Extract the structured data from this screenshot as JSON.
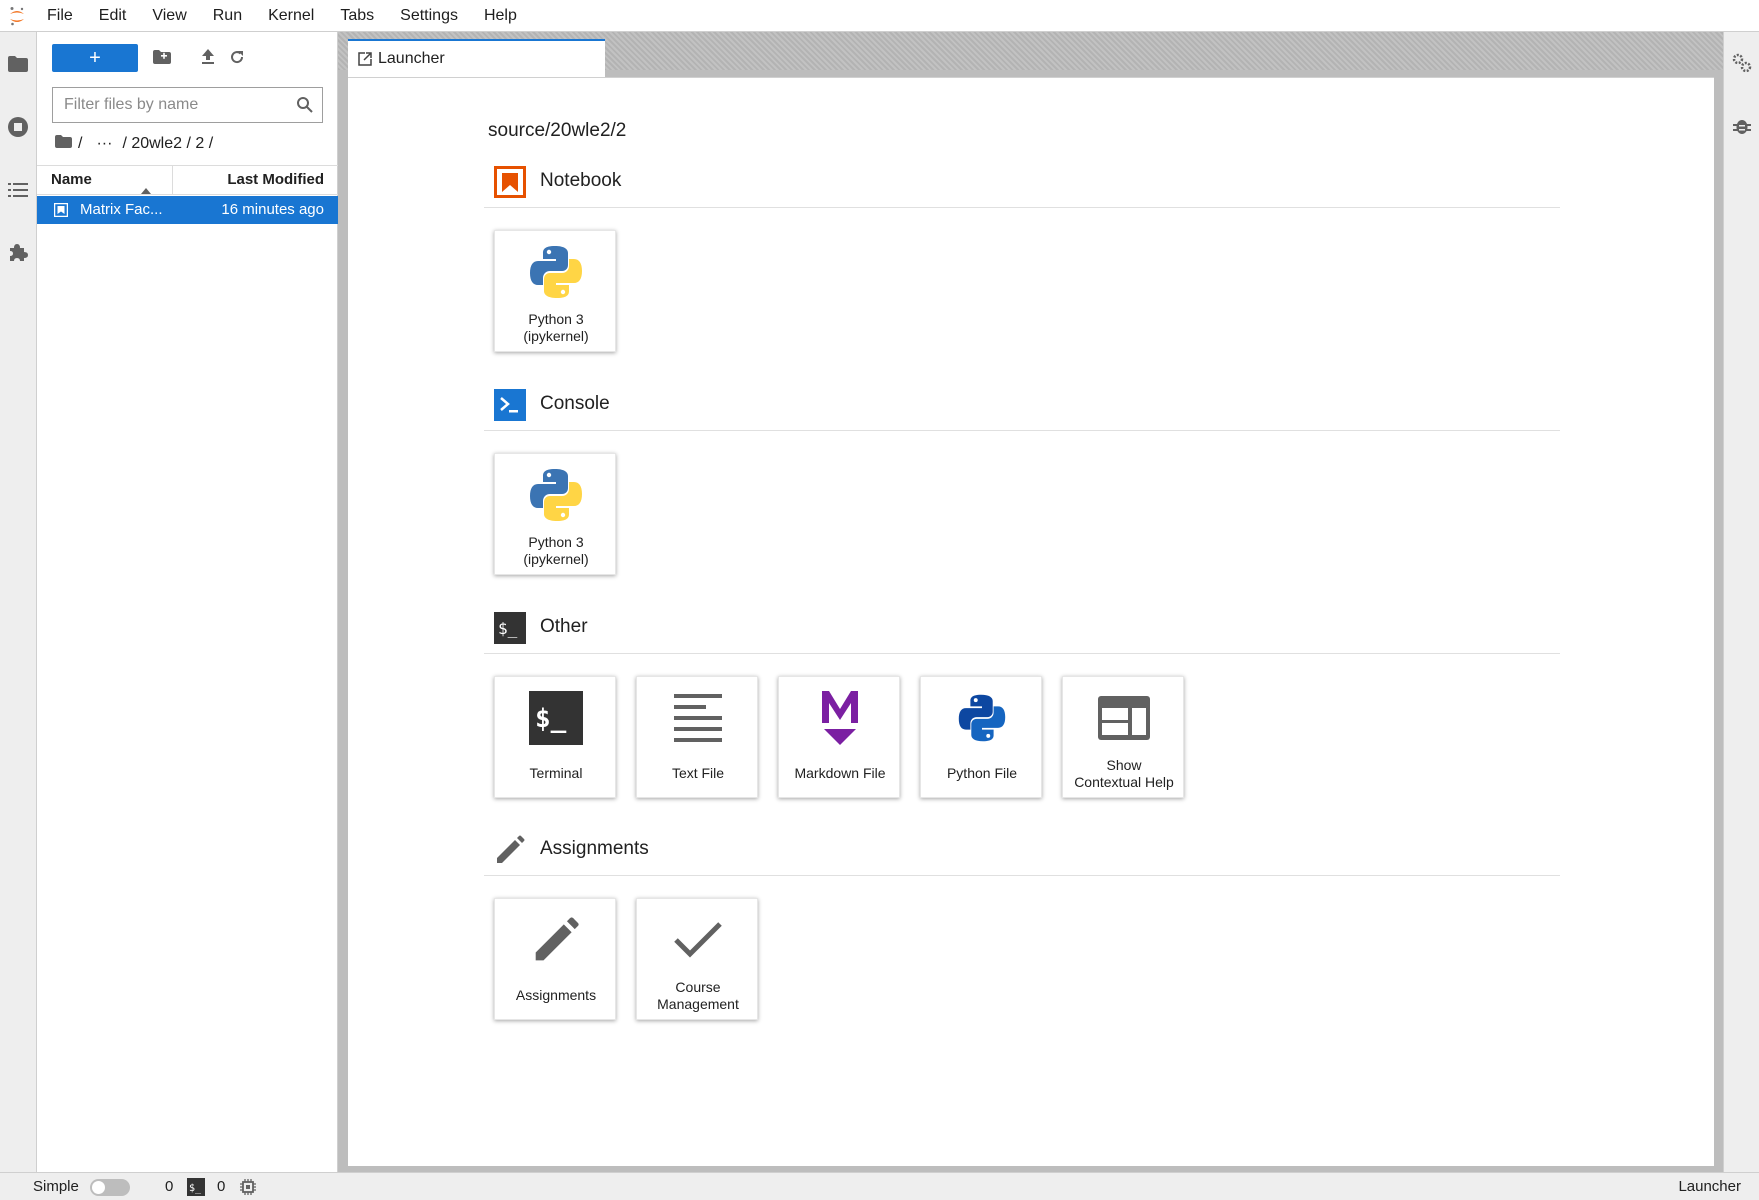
{
  "menubar": {
    "items": [
      "File",
      "Edit",
      "View",
      "Run",
      "Kernel",
      "Tabs",
      "Settings",
      "Help"
    ]
  },
  "file_browser": {
    "new_button_label": "+",
    "filter_placeholder": "Filter files by name",
    "breadcrumb": {
      "root_sep": "/",
      "ellipsis": "···",
      "path": "/ 20wle2 / 2 /"
    },
    "columns": {
      "name": "Name",
      "last_modified": "Last Modified"
    },
    "files": [
      {
        "name": "Matrix Fac...",
        "modified": "16 minutes ago",
        "selected": true
      }
    ]
  },
  "tabs": [
    {
      "label": "Launcher",
      "active": true
    }
  ],
  "launcher": {
    "cwd": "source/20wle2/2",
    "sections": {
      "notebook": {
        "title": "Notebook",
        "cards": [
          {
            "label_line1": "Python 3",
            "label_line2": "(ipykernel)",
            "icon": "python-logo-icon"
          }
        ]
      },
      "console": {
        "title": "Console",
        "cards": [
          {
            "label_line1": "Python 3",
            "label_line2": "(ipykernel)",
            "icon": "python-logo-icon"
          }
        ]
      },
      "other": {
        "title": "Other",
        "cards": [
          {
            "label_line1": "Terminal",
            "icon": "terminal-icon"
          },
          {
            "label_line1": "Text File",
            "icon": "text-file-icon"
          },
          {
            "label_line1": "Markdown File",
            "icon": "markdown-icon"
          },
          {
            "label_line1": "Python File",
            "icon": "python-file-icon"
          },
          {
            "label_line1": "Show",
            "label_line2": "Contextual Help",
            "icon": "contextual-help-icon"
          }
        ]
      },
      "assignments": {
        "title": "Assignments",
        "cards": [
          {
            "label_line1": "Assignments",
            "icon": "pencil-icon"
          },
          {
            "label_line1": "Course",
            "label_line2": "Management",
            "icon": "checkmark-icon"
          }
        ]
      }
    }
  },
  "statusbar": {
    "mode_label": "Simple",
    "kernels_count": "0",
    "terminals_count": "0",
    "right_label": "Launcher"
  },
  "colors": {
    "accent": "#1976d2",
    "notebook_orange": "#e65100",
    "markdown_purple": "#7b1fa2",
    "icon_gray": "#616161"
  }
}
